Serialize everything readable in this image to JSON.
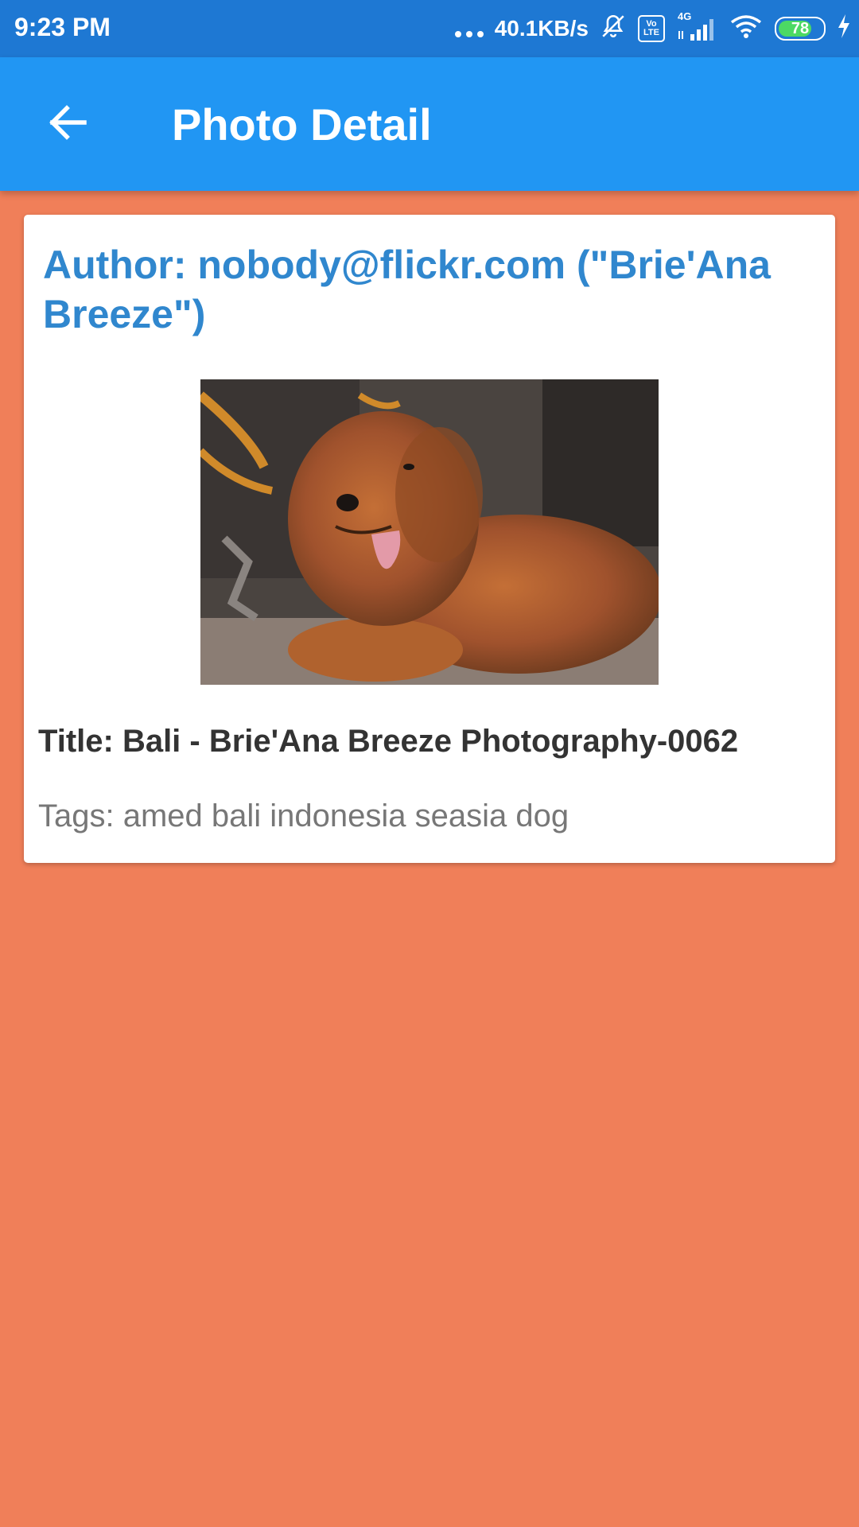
{
  "status_bar": {
    "time": "9:23 PM",
    "net_speed": "40.1KB/s",
    "volte_top": "Vo",
    "volte_bottom": "LTE",
    "network_type": "4G",
    "battery_level": "78",
    "icons": [
      "more-dots-icon",
      "bell-off-icon",
      "volte-icon",
      "signal-icon",
      "wifi-icon",
      "battery-icon",
      "charging-bolt-icon"
    ]
  },
  "app_bar": {
    "title": "Photo Detail",
    "back_icon": "arrow-left-icon",
    "color": "#2196F3"
  },
  "card": {
    "author": "Author: nobody@flickr.com (\"Brie'Ana Breeze\")",
    "photo_subject": "dog-photo",
    "title": "Title: Bali - Brie'Ana Breeze Photography-0062",
    "tags": "Tags: amed bali indonesia seasia dog"
  },
  "colors": {
    "background": "#F07F59",
    "status_bar": "#1E78D3",
    "author_text": "#3087CE"
  }
}
